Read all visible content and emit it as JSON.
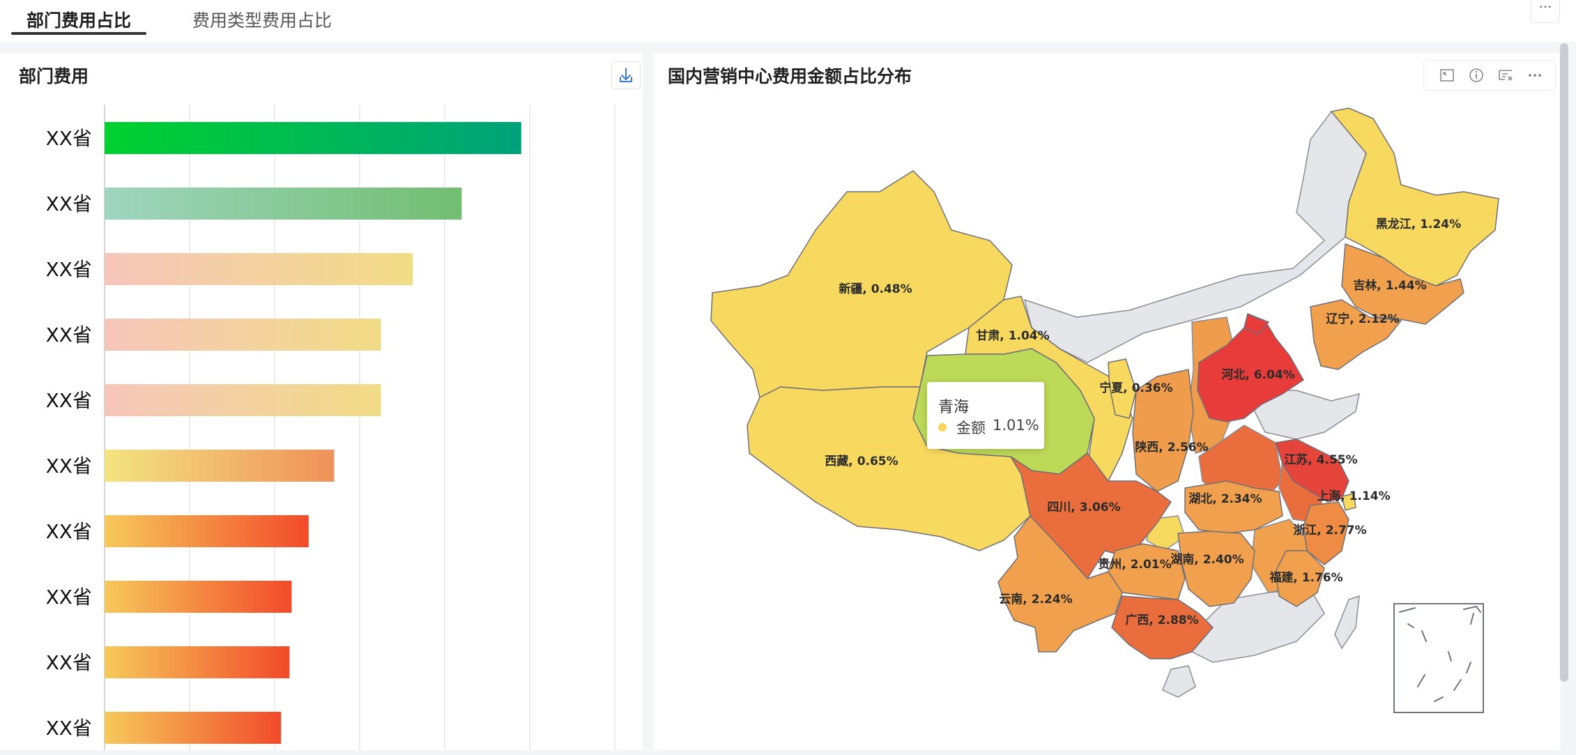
{
  "tabs": [
    {
      "label": "部门费用占比",
      "active": true
    },
    {
      "label": "费用类型费用占比",
      "active": false
    }
  ],
  "more_label": "···",
  "left_panel": {
    "title": "部门费用"
  },
  "right_panel": {
    "title": "国内营销中心费用金额占比分布"
  },
  "chart_data": [
    {
      "type": "bar",
      "orientation": "horizontal",
      "title": "部门费用",
      "categories": [
        "XX省",
        "XX省",
        "XX省",
        "XX省",
        "XX省",
        "XX省",
        "XX省",
        "XX省",
        "XX省",
        "XX省"
      ],
      "values": [
        98,
        84,
        72.5,
        65,
        65,
        54,
        48,
        44,
        43.5,
        41.5
      ],
      "xlim": [
        0,
        120
      ],
      "grid": true,
      "colors": [
        [
          "#00d12f",
          "#00a27a"
        ],
        [
          "#9fd5c0",
          "#72be71"
        ],
        [
          "#f6c6bb",
          "#f1dc86"
        ],
        [
          "#f6c6bb",
          "#f1dc86"
        ],
        [
          "#f6c6bb",
          "#f1dc86"
        ],
        [
          "#f3e481",
          "#f0915a"
        ],
        [
          "#f6c95b",
          "#f24a2a"
        ],
        [
          "#f6c95b",
          "#f24a2a"
        ],
        [
          "#f6c95b",
          "#f24a2a"
        ],
        [
          "#f6c95b",
          "#f24a2a"
        ]
      ]
    },
    {
      "type": "map",
      "title": "国内营销中心费用金额占比分布",
      "metric": "金额",
      "regions": [
        {
          "name": "黑龙江",
          "value": "1.24%",
          "color": "#f8d95f"
        },
        {
          "name": "吉林",
          "value": "1.44%",
          "color": "#f1a04d"
        },
        {
          "name": "辽宁",
          "value": "2.12%",
          "color": "#f1a04d"
        },
        {
          "name": "新疆",
          "value": "0.48%",
          "color": "#f8d95f"
        },
        {
          "name": "甘肃",
          "value": "1.04%",
          "color": "#f8d95f"
        },
        {
          "name": "宁夏",
          "value": "0.36%",
          "color": "#f8d95f"
        },
        {
          "name": "河北",
          "value": "6.04%",
          "color": "#e83c3a"
        },
        {
          "name": "青海",
          "value": "1.01%",
          "color": "#bdd958"
        },
        {
          "name": "西藏",
          "value": "0.65%",
          "color": "#f8d95f"
        },
        {
          "name": "陕西",
          "value": "2.56%",
          "color": "#ef9c4c"
        },
        {
          "name": "江苏",
          "value": "4.55%",
          "color": "#e5443a"
        },
        {
          "name": "上海",
          "value": "1.14%",
          "color": "#f8d95f"
        },
        {
          "name": "四川",
          "value": "3.06%",
          "color": "#ea6d3e"
        },
        {
          "name": "湖北",
          "value": "2.34%",
          "color": "#f1a04d"
        },
        {
          "name": "浙江",
          "value": "2.77%",
          "color": "#ee8c46"
        },
        {
          "name": "湖南",
          "value": "2.40%",
          "color": "#f1a04d"
        },
        {
          "name": "贵州",
          "value": "2.01%",
          "color": "#f1a04d"
        },
        {
          "name": "福建",
          "value": "1.76%",
          "color": "#f1a04d"
        },
        {
          "name": "云南",
          "value": "2.24%",
          "color": "#f1a04d"
        },
        {
          "name": "广西",
          "value": "2.88%",
          "color": "#ea6d3e"
        }
      ],
      "tooltip": {
        "region": "青海",
        "label": "金额",
        "value": "1.01%"
      }
    }
  ]
}
